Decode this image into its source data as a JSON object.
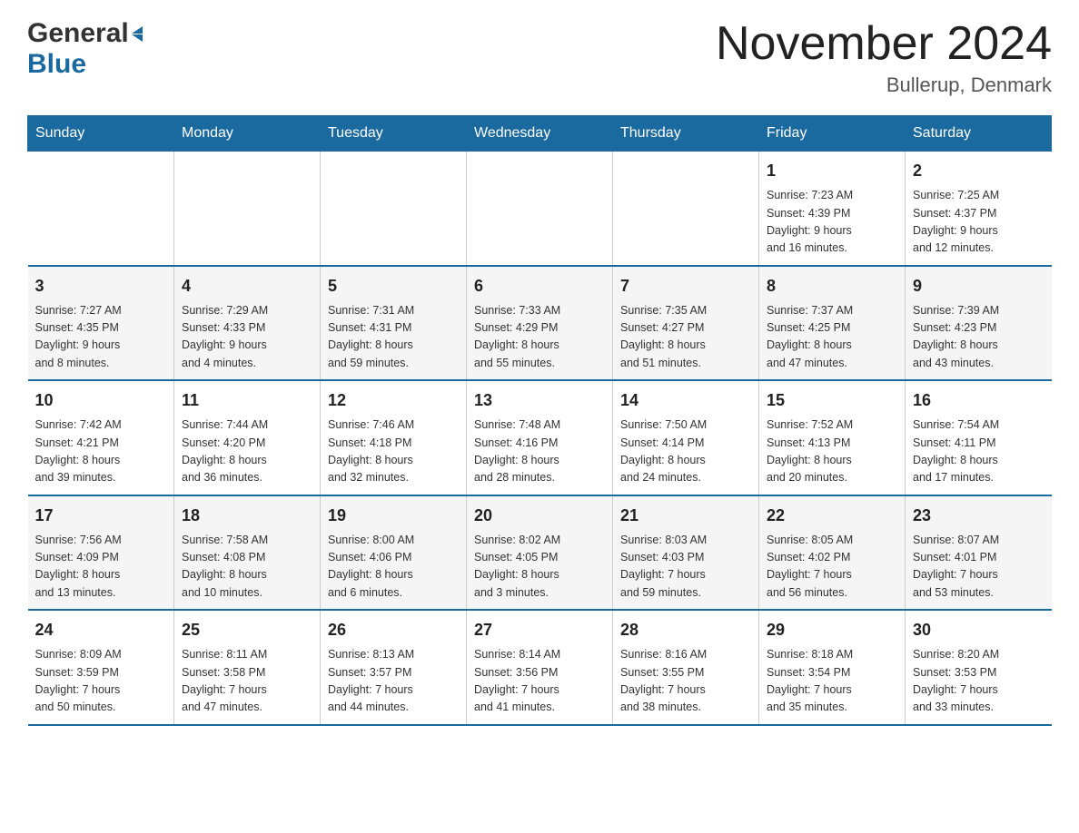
{
  "header": {
    "logo_general": "General",
    "logo_blue": "Blue",
    "month_title": "November 2024",
    "location": "Bullerup, Denmark"
  },
  "weekdays": [
    "Sunday",
    "Monday",
    "Tuesday",
    "Wednesday",
    "Thursday",
    "Friday",
    "Saturday"
  ],
  "weeks": [
    [
      {
        "day": "",
        "info": ""
      },
      {
        "day": "",
        "info": ""
      },
      {
        "day": "",
        "info": ""
      },
      {
        "day": "",
        "info": ""
      },
      {
        "day": "",
        "info": ""
      },
      {
        "day": "1",
        "info": "Sunrise: 7:23 AM\nSunset: 4:39 PM\nDaylight: 9 hours\nand 16 minutes."
      },
      {
        "day": "2",
        "info": "Sunrise: 7:25 AM\nSunset: 4:37 PM\nDaylight: 9 hours\nand 12 minutes."
      }
    ],
    [
      {
        "day": "3",
        "info": "Sunrise: 7:27 AM\nSunset: 4:35 PM\nDaylight: 9 hours\nand 8 minutes."
      },
      {
        "day": "4",
        "info": "Sunrise: 7:29 AM\nSunset: 4:33 PM\nDaylight: 9 hours\nand 4 minutes."
      },
      {
        "day": "5",
        "info": "Sunrise: 7:31 AM\nSunset: 4:31 PM\nDaylight: 8 hours\nand 59 minutes."
      },
      {
        "day": "6",
        "info": "Sunrise: 7:33 AM\nSunset: 4:29 PM\nDaylight: 8 hours\nand 55 minutes."
      },
      {
        "day": "7",
        "info": "Sunrise: 7:35 AM\nSunset: 4:27 PM\nDaylight: 8 hours\nand 51 minutes."
      },
      {
        "day": "8",
        "info": "Sunrise: 7:37 AM\nSunset: 4:25 PM\nDaylight: 8 hours\nand 47 minutes."
      },
      {
        "day": "9",
        "info": "Sunrise: 7:39 AM\nSunset: 4:23 PM\nDaylight: 8 hours\nand 43 minutes."
      }
    ],
    [
      {
        "day": "10",
        "info": "Sunrise: 7:42 AM\nSunset: 4:21 PM\nDaylight: 8 hours\nand 39 minutes."
      },
      {
        "day": "11",
        "info": "Sunrise: 7:44 AM\nSunset: 4:20 PM\nDaylight: 8 hours\nand 36 minutes."
      },
      {
        "day": "12",
        "info": "Sunrise: 7:46 AM\nSunset: 4:18 PM\nDaylight: 8 hours\nand 32 minutes."
      },
      {
        "day": "13",
        "info": "Sunrise: 7:48 AM\nSunset: 4:16 PM\nDaylight: 8 hours\nand 28 minutes."
      },
      {
        "day": "14",
        "info": "Sunrise: 7:50 AM\nSunset: 4:14 PM\nDaylight: 8 hours\nand 24 minutes."
      },
      {
        "day": "15",
        "info": "Sunrise: 7:52 AM\nSunset: 4:13 PM\nDaylight: 8 hours\nand 20 minutes."
      },
      {
        "day": "16",
        "info": "Sunrise: 7:54 AM\nSunset: 4:11 PM\nDaylight: 8 hours\nand 17 minutes."
      }
    ],
    [
      {
        "day": "17",
        "info": "Sunrise: 7:56 AM\nSunset: 4:09 PM\nDaylight: 8 hours\nand 13 minutes."
      },
      {
        "day": "18",
        "info": "Sunrise: 7:58 AM\nSunset: 4:08 PM\nDaylight: 8 hours\nand 10 minutes."
      },
      {
        "day": "19",
        "info": "Sunrise: 8:00 AM\nSunset: 4:06 PM\nDaylight: 8 hours\nand 6 minutes."
      },
      {
        "day": "20",
        "info": "Sunrise: 8:02 AM\nSunset: 4:05 PM\nDaylight: 8 hours\nand 3 minutes."
      },
      {
        "day": "21",
        "info": "Sunrise: 8:03 AM\nSunset: 4:03 PM\nDaylight: 7 hours\nand 59 minutes."
      },
      {
        "day": "22",
        "info": "Sunrise: 8:05 AM\nSunset: 4:02 PM\nDaylight: 7 hours\nand 56 minutes."
      },
      {
        "day": "23",
        "info": "Sunrise: 8:07 AM\nSunset: 4:01 PM\nDaylight: 7 hours\nand 53 minutes."
      }
    ],
    [
      {
        "day": "24",
        "info": "Sunrise: 8:09 AM\nSunset: 3:59 PM\nDaylight: 7 hours\nand 50 minutes."
      },
      {
        "day": "25",
        "info": "Sunrise: 8:11 AM\nSunset: 3:58 PM\nDaylight: 7 hours\nand 47 minutes."
      },
      {
        "day": "26",
        "info": "Sunrise: 8:13 AM\nSunset: 3:57 PM\nDaylight: 7 hours\nand 44 minutes."
      },
      {
        "day": "27",
        "info": "Sunrise: 8:14 AM\nSunset: 3:56 PM\nDaylight: 7 hours\nand 41 minutes."
      },
      {
        "day": "28",
        "info": "Sunrise: 8:16 AM\nSunset: 3:55 PM\nDaylight: 7 hours\nand 38 minutes."
      },
      {
        "day": "29",
        "info": "Sunrise: 8:18 AM\nSunset: 3:54 PM\nDaylight: 7 hours\nand 35 minutes."
      },
      {
        "day": "30",
        "info": "Sunrise: 8:20 AM\nSunset: 3:53 PM\nDaylight: 7 hours\nand 33 minutes."
      }
    ]
  ]
}
